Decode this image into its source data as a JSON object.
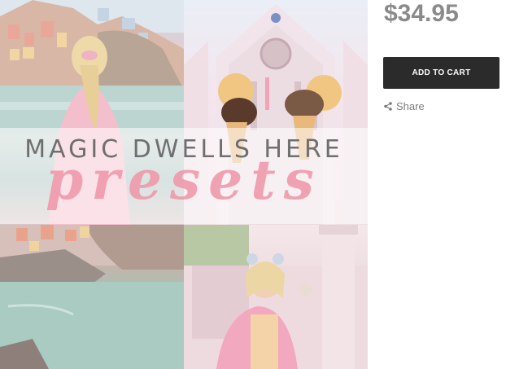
{
  "product": {
    "price": "$34.95",
    "add_to_cart_label": "ADD TO CART",
    "share_label": "Share"
  },
  "collage": {
    "headline": "MAGIC DWELLS HERE",
    "script_word": "presets"
  },
  "icons": {
    "share": "share-icon"
  },
  "colors": {
    "button_bg": "#2b2b2b",
    "price_text": "#8a8a8a",
    "script_pink": "#ef96a8"
  }
}
